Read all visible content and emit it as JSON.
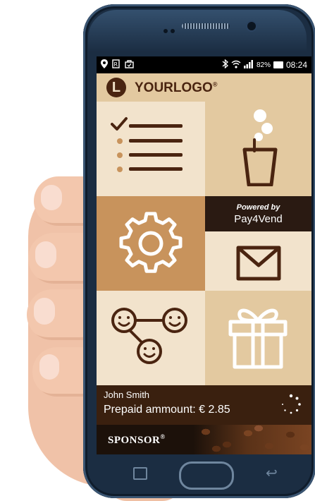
{
  "status_bar": {
    "battery": "82%",
    "time": "08:24",
    "icons_left": [
      "location-icon",
      "prescription-icon",
      "shopping-bag-icon"
    ],
    "icons_right": [
      "bluetooth-icon",
      "wifi-icon",
      "signal-icon",
      "battery-icon"
    ]
  },
  "header": {
    "logo_letter": "L",
    "logo_text": "YOURLOGO",
    "logo_mark": "®"
  },
  "tiles": {
    "powered_by_line1": "Powered by",
    "powered_by_line2": "Pay4Vend"
  },
  "account": {
    "user_name": "John Smith",
    "prepaid_label": "Prepaid ammount: € 2.85"
  },
  "sponsor": {
    "label": "SPONSOR",
    "mark": "®"
  },
  "colors": {
    "dark_brown": "#4a2410",
    "tile_light": "#f2e3cc",
    "tile_mid": "#e3c9a0",
    "tile_accent": "#c8935c",
    "info_bar": "#3a200f"
  }
}
